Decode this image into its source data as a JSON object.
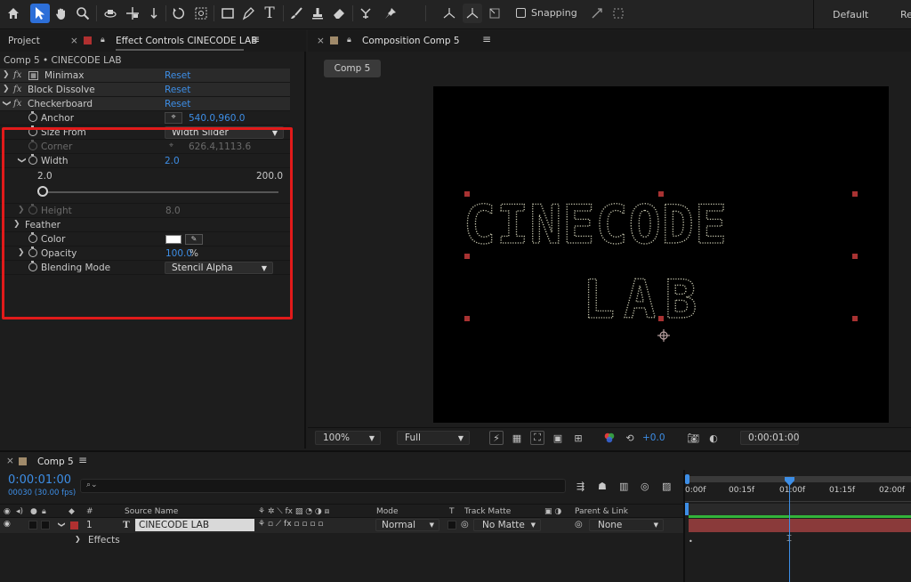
{
  "toolbar": {
    "tools": [
      "home-icon",
      "selection-tool-icon",
      "hand-tool-icon",
      "zoom-tool-icon",
      "orbit-camera-icon",
      "pan-camera-icon",
      "dolly-camera-icon",
      "rotate-tool-icon",
      "anchor-point-tool-icon",
      "rectangle-tool-icon",
      "pen-tool-icon",
      "type-tool-icon",
      "brush-tool-icon",
      "clone-stamp-icon",
      "eraser-tool-icon",
      "roto-brush-icon",
      "puppet-pin-icon"
    ],
    "snapping_label": "Snapping",
    "workspace_default": "Default",
    "workspace_next": "Re"
  },
  "left_panel": {
    "tab_project": "Project",
    "tab_effect_controls": "Effect Controls CINECODE LAB",
    "subtitle": "Comp 5 • CINECODE LAB",
    "effects": [
      {
        "name": "Minimax",
        "reset": "Reset"
      },
      {
        "name": "Block Dissolve",
        "reset": "Reset"
      },
      {
        "name": "Checkerboard",
        "reset": "Reset"
      }
    ],
    "props": {
      "anchor": {
        "label": "Anchor",
        "value": "540.0,960.0"
      },
      "size_from": {
        "label": "Size From",
        "value": "Width Slider"
      },
      "corner": {
        "label": "Corner",
        "value": "626.4,1113.6"
      },
      "width": {
        "label": "Width",
        "value": "2.0",
        "min": "2.0",
        "max": "200.0"
      },
      "height": {
        "label": "Height",
        "value": "8.0"
      },
      "feather": {
        "label": "Feather"
      },
      "color": {
        "label": "Color",
        "value": "#ffffff"
      },
      "opacity": {
        "label": "Opacity",
        "value": "100.0",
        "unit": "%"
      },
      "blending": {
        "label": "Blending Mode",
        "value": "Stencil Alpha"
      }
    }
  },
  "comp_panel": {
    "tab_title": "Composition Comp 5",
    "chip": "Comp 5",
    "zoom": "100%",
    "resolution": "Full",
    "exposure": "+0.0",
    "timecode": "0:00:01:00",
    "canvas_text": [
      "CINECODE",
      "LAB"
    ]
  },
  "timeline": {
    "tab": "Comp 5",
    "timecode": "0:00:01:00",
    "fps": "00030 (30.00 fps)",
    "search_placeholder": "",
    "col_num": "#",
    "col_source": "Source Name",
    "col_mode": "Mode",
    "col_t": "T",
    "col_trackmatte": "Track Matte",
    "col_parent": "Parent & Link",
    "layer": {
      "num": "1",
      "type": "T",
      "name": "CINECODE LAB",
      "mode": "Normal",
      "matte": "No Matte",
      "parent": "None"
    },
    "effects_label": "Effects",
    "ruler": [
      "0:00f",
      "00:15f",
      "01:00f",
      "01:15f",
      "02:00f"
    ]
  },
  "colors": {
    "accent": "#3d8ee6",
    "highlight_box": "#e11a1a",
    "layer_bar": "#8a3a3a",
    "green_line": "#33b43a"
  }
}
